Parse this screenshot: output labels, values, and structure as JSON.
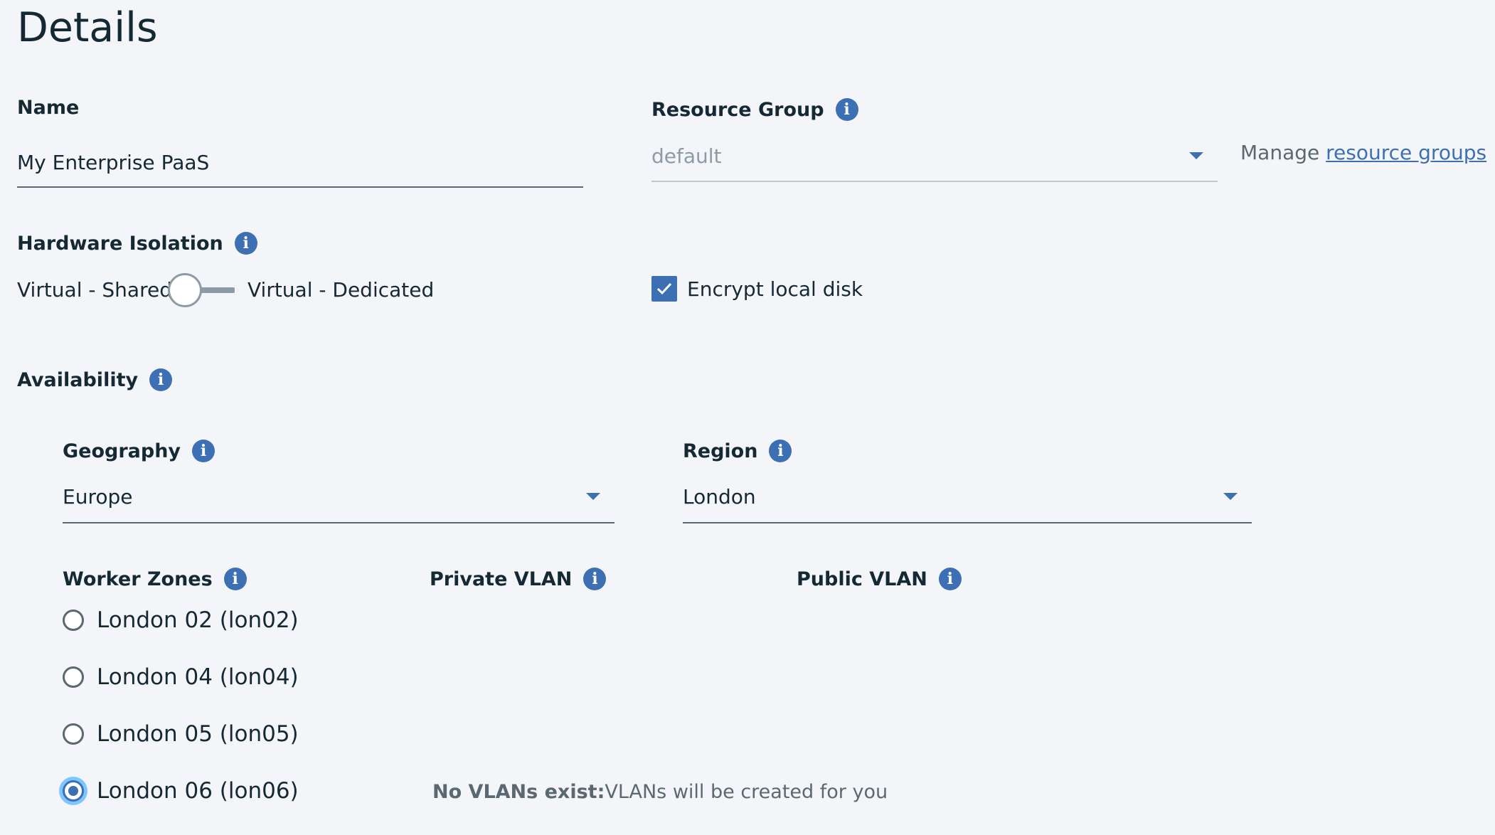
{
  "page": {
    "title": "Details"
  },
  "name_field": {
    "label": "Name",
    "value": "My Enterprise PaaS"
  },
  "resource_group": {
    "label": "Resource Group",
    "selected": "default",
    "manage_prefix": "Manage",
    "manage_link": "resource groups"
  },
  "hardware_isolation": {
    "label": "Hardware Isolation",
    "left_option": "Virtual - Shared",
    "right_option": "Virtual - Dedicated",
    "toggle_on": false
  },
  "encrypt": {
    "label": "Encrypt local disk",
    "checked": true
  },
  "availability": {
    "label": "Availability"
  },
  "geography": {
    "label": "Geography",
    "selected": "Europe"
  },
  "region": {
    "label": "Region",
    "selected": "London"
  },
  "worker_zones": {
    "label": "Worker Zones",
    "zones": [
      {
        "label": "London 02 (lon02)",
        "selected": false
      },
      {
        "label": "London 04 (lon04)",
        "selected": false
      },
      {
        "label": "London 05 (lon05)",
        "selected": false
      },
      {
        "label": "London 06 (lon06)",
        "selected": true
      }
    ]
  },
  "private_vlan": {
    "label": "Private VLAN"
  },
  "public_vlan": {
    "label": "Public VLAN"
  },
  "vlan_notice": {
    "bold": "No VLANs exist:",
    "text": "VLANs will be created for you"
  },
  "icons": {
    "info": "info-icon",
    "checkmark": "checkmark-icon",
    "caret": "chevron-down-icon"
  },
  "colors": {
    "accent": "#3d70b2",
    "background": "#f4f5f8",
    "focus_ring": "#7cc7ff"
  }
}
